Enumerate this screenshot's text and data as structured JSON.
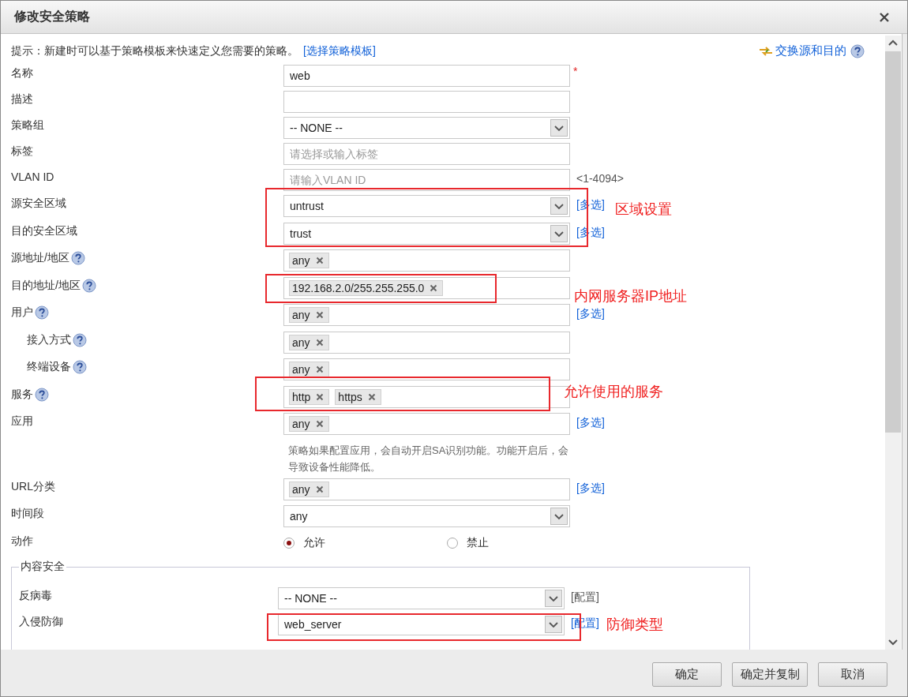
{
  "window": {
    "title": "修改安全策略"
  },
  "hint": {
    "text": "提示：新建时可以基于策略模板来快速定义您需要的策略。",
    "link": "[选择策略模板]"
  },
  "swap_link": "交换源和目的",
  "fields": [
    {
      "label": "名称",
      "kind": "text",
      "value": "web",
      "required_mark": "*"
    },
    {
      "label": "描述",
      "kind": "text"
    },
    {
      "label": "策略组",
      "kind": "select",
      "value": "-- NONE --"
    },
    {
      "label": "标签",
      "kind": "text",
      "placeholder": "请选择或输入标签"
    },
    {
      "label": "VLAN ID",
      "kind": "text",
      "placeholder": "请输入VLAN ID",
      "side": {
        "kind": "note",
        "text": "<1-4094>"
      }
    },
    {
      "label": "源安全区域",
      "kind": "select",
      "value": "untrust",
      "side": {
        "kind": "link",
        "text": "[多选]"
      }
    },
    {
      "label": "目的安全区域",
      "kind": "select",
      "value": "trust",
      "side": {
        "kind": "link",
        "text": "[多选]"
      }
    },
    {
      "label": "源地址/地区",
      "kind": "tags",
      "help": true,
      "tags": [
        "any"
      ]
    },
    {
      "label": "目的地址/地区",
      "kind": "tags",
      "help": true,
      "tags": [
        "192.168.2.0/255.255.255.0"
      ]
    },
    {
      "label": "用户",
      "kind": "tags",
      "help": true,
      "tags": [
        "any"
      ],
      "side": {
        "kind": "link",
        "text": "[多选]"
      },
      "children": [
        {
          "label": "接入方式",
          "kind": "tags",
          "help": true,
          "tags": [
            "any"
          ]
        },
        {
          "label": "终端设备",
          "kind": "tags",
          "help": true,
          "tags": [
            "any"
          ]
        }
      ]
    },
    {
      "label": "服务",
      "kind": "tags",
      "help": true,
      "tags": [
        "http",
        "https"
      ]
    },
    {
      "label": "应用",
      "kind": "tags",
      "tags": [
        "any"
      ],
      "side": {
        "kind": "link",
        "text": "[多选]"
      }
    },
    {
      "kind": "note",
      "text": "策略如果配置应用，会自动开启SA识别功能。功能开启后，会导致设备性能降低。"
    },
    {
      "label": "URL分类",
      "kind": "tags",
      "tags": [
        "any"
      ],
      "side": {
        "kind": "link",
        "text": "[多选]"
      }
    },
    {
      "label": "时间段",
      "kind": "select",
      "value": "any"
    },
    {
      "label": "动作",
      "kind": "radio",
      "options": [
        {
          "label": "允许",
          "selected": true
        },
        {
          "label": "禁止",
          "selected": false
        }
      ]
    }
  ],
  "content_security": {
    "legend": "内容安全",
    "fields": [
      {
        "label": "反病毒",
        "kind": "select",
        "value": "-- NONE --",
        "side": {
          "kind": "plain",
          "text": "[配置]"
        }
      },
      {
        "label": "入侵防御",
        "kind": "select",
        "value": "web_server",
        "side": {
          "kind": "link",
          "text": "[配置]"
        }
      }
    ]
  },
  "annotations": [
    {
      "text": "区域设置"
    },
    {
      "text": "内网服务器IP地址"
    },
    {
      "text": "允许使用的服务"
    },
    {
      "text": "防御类型"
    }
  ],
  "buttons": [
    {
      "label": "确定"
    },
    {
      "label": "确定并复制"
    },
    {
      "label": "取消"
    }
  ]
}
